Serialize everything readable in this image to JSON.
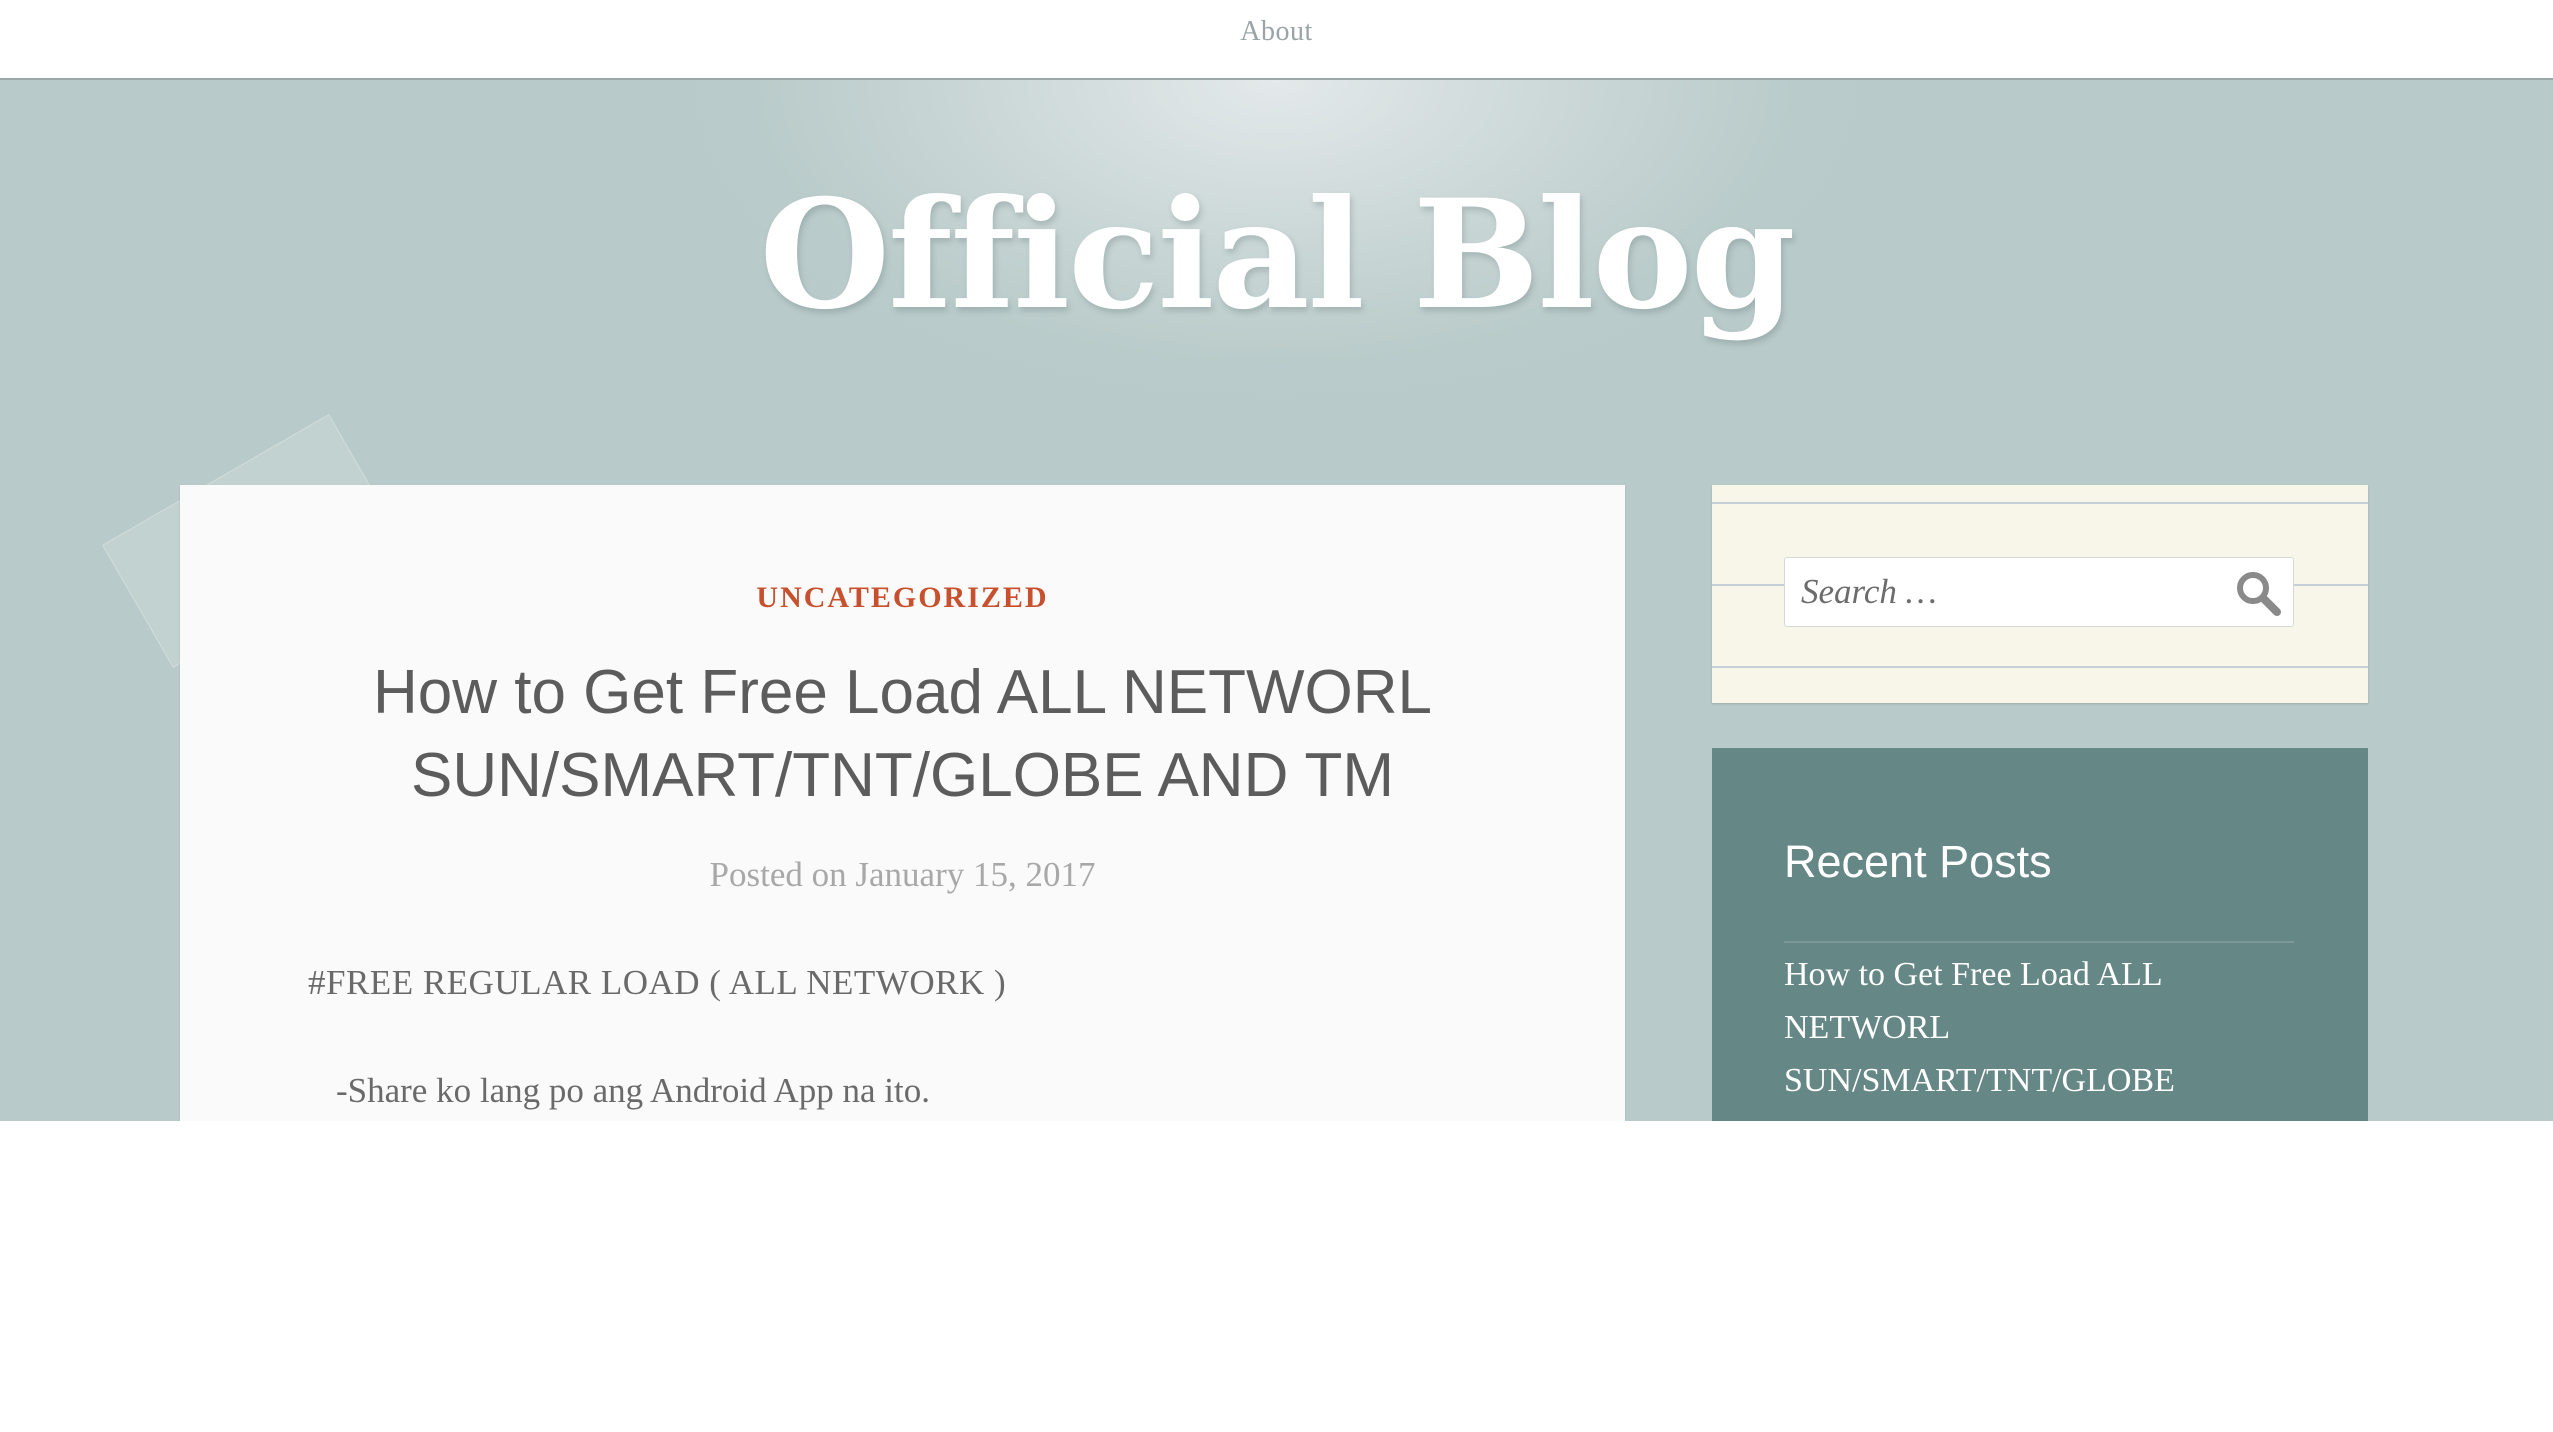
{
  "nav": {
    "about_label": "About"
  },
  "header": {
    "site_title": "Official Blog"
  },
  "post": {
    "category": "UNCATEGORIZED",
    "title": "How to Get Free Load ALL NETWORL SUN/SMART/TNT/GLOBE AND TM",
    "posted_on_label": "Posted on",
    "date": "January 15, 2017",
    "line1": "#FREE REGULAR LOAD ( ALL NETWORK )",
    "line2": "-Share ko lang po ang Android App na ito."
  },
  "sidebar": {
    "search": {
      "placeholder": "Search …",
      "icon": "search-icon"
    },
    "recent_posts": {
      "title": "Recent Posts",
      "items": [
        {
          "label": "How to Get Free Load ALL NETWORL SUN/SMART/TNT/GLOBE"
        }
      ]
    }
  },
  "colors": {
    "header_bg": "#b8cac9",
    "category": "#c7502e",
    "recent_widget_bg": "#658785",
    "search_widget_bg": "#f8f6e8"
  }
}
